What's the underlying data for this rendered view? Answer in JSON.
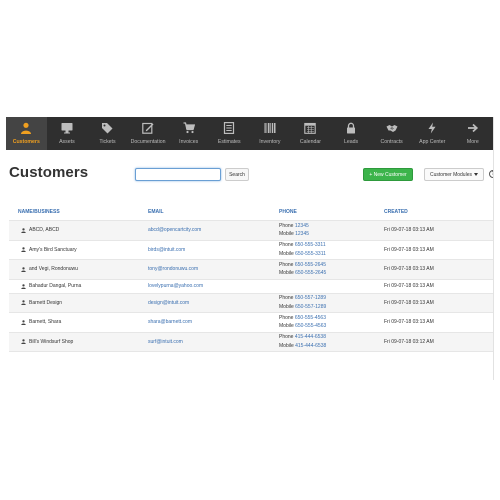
{
  "nav": [
    {
      "label": "Customers",
      "icon": "user-icon",
      "active": true
    },
    {
      "label": "Assets",
      "icon": "monitor-icon"
    },
    {
      "label": "Tickets",
      "icon": "tag-icon"
    },
    {
      "label": "Documentation",
      "icon": "edit-icon"
    },
    {
      "label": "Invoices",
      "icon": "cart-icon"
    },
    {
      "label": "Estimates",
      "icon": "document-icon"
    },
    {
      "label": "Inventory",
      "icon": "barcode-icon"
    },
    {
      "label": "Calendar",
      "icon": "calendar-icon"
    },
    {
      "label": "Leads",
      "icon": "lock-icon"
    },
    {
      "label": "Contracts",
      "icon": "handshake-icon"
    },
    {
      "label": "App Center",
      "icon": "bolt-icon"
    },
    {
      "label": "More",
      "icon": "arrow-right-icon"
    }
  ],
  "page": {
    "title": "Customers"
  },
  "search": {
    "value": "",
    "button": "Search"
  },
  "actions": {
    "new_customer": "+ New Customer",
    "modules": "Customer Modules",
    "help": "?"
  },
  "table": {
    "headers": {
      "name": "NAME/BUSINESS",
      "email": "EMAIL",
      "phone": "PHONE",
      "created": "CREATED"
    },
    "rows": [
      {
        "name": "ABCD, ABCD",
        "email": "abcd@opencartcity.com",
        "phone_label": "Phone",
        "phone": "12345",
        "mobile_label": "Mobile",
        "mobile": "12345",
        "created": "Fri 09-07-18 03:13 AM"
      },
      {
        "name": "Amy's Bird Sanctuary",
        "email": "birds@intuit.com",
        "phone_label": "Phone",
        "phone": "650-555-3311",
        "mobile_label": "Mobile",
        "mobile": "650-555-3311",
        "created": "Fri 09-07-18 03:13 AM"
      },
      {
        "name": "and Vegi, Rondonuwu",
        "email": "tony@rondonuwu.com",
        "phone_label": "Phone",
        "phone": "650-555-2645",
        "mobile_label": "Mobile",
        "mobile": "650-555-2645",
        "created": "Fri 09-07-18 03:13 AM"
      },
      {
        "name": "Bahadur Dangal, Purna",
        "email": "lovelypurna@yahoo.com",
        "created": "Fri 09-07-18 03:13 AM"
      },
      {
        "name": "Barnett Design",
        "email": "design@intuit.com",
        "phone_label": "Phone",
        "phone": "650-557-1289",
        "mobile_label": "Mobile",
        "mobile": "650-557-1289",
        "created": "Fri 09-07-18 03:13 AM"
      },
      {
        "name": "Barnett, Shara",
        "email": "shara@barnett.com",
        "phone_label": "Phone",
        "phone": "650-555-4563",
        "mobile_label": "Mobile",
        "mobile": "650-555-4563",
        "created": "Fri 09-07-18 03:13 AM"
      },
      {
        "name": "Bill's Windsurf Shop",
        "email": "surf@intuit.com",
        "phone_label": "Phone",
        "phone": "415-444-6538",
        "mobile_label": "Mobile",
        "mobile": "415-444-6538",
        "created": "Fri 09-07-18 03:12 AM"
      }
    ]
  },
  "colors": {
    "nav_bg": "#2f2f2f",
    "active": "#f0a020",
    "link": "#3a6fb0",
    "primary": "#3cb44b"
  }
}
